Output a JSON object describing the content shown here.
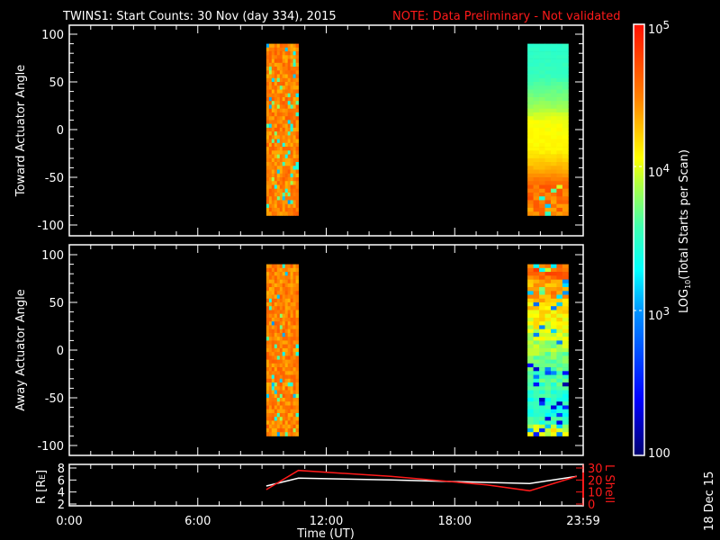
{
  "title": {
    "main": "TWINS1: Start Counts: 30 Nov (day 334), 2015",
    "note": "NOTE: Data Preliminary - Not validated",
    "note_color": "#ff1a1a"
  },
  "date_stamp": "18 Dec 15",
  "chart_data": {
    "type": "heatmap",
    "xlabel": "Time (UT)",
    "x_range_hours": [
      0,
      24
    ],
    "x_ticks": [
      "0:00",
      "6:00",
      "12:00",
      "18:00",
      "23:59"
    ],
    "colorbar": {
      "label": "LOG10(Total Starts per Scan)",
      "label_main": "LOG",
      "label_sub": "10",
      "label_rest": "(Total Starts per Scan)",
      "range_log10": [
        2,
        5
      ],
      "ticks": [
        {
          "base": "100",
          "exp": ""
        },
        {
          "base": "10",
          "exp": "3"
        },
        {
          "base": "10",
          "exp": "4"
        },
        {
          "base": "10",
          "exp": "5"
        }
      ]
    },
    "panels": [
      {
        "ylabel": "Toward Actuator Angle",
        "ylim": [
          -100,
          100
        ],
        "y_ticks": [
          "100",
          "50",
          "0",
          "-50",
          "-100"
        ],
        "blocks": [
          {
            "t_start": 9.2,
            "t_end": 10.7,
            "noisy_from": 90,
            "profile": [
              [
                90,
                4.5
              ],
              [
                0,
                4.5
              ],
              [
                -88,
                4.5
              ]
            ]
          },
          {
            "t_start": 21.4,
            "t_end": 23.3,
            "noisy_from": -58,
            "profile": [
              [
                90,
                3.5
              ],
              [
                60,
                3.55
              ],
              [
                30,
                3.8
              ],
              [
                10,
                4.05
              ],
              [
                -20,
                4.1
              ],
              [
                -40,
                4.35
              ],
              [
                -55,
                4.6
              ],
              [
                -88,
                4.5
              ]
            ]
          }
        ]
      },
      {
        "ylabel": "Away Actuator Angle",
        "ylim": [
          -100,
          100
        ],
        "y_ticks": [
          "100",
          "50",
          "0",
          "-50",
          "-100"
        ],
        "blocks": [
          {
            "t_start": 9.2,
            "t_end": 10.7,
            "noisy_from": 90,
            "profile": [
              [
                90,
                4.5
              ],
              [
                0,
                4.5
              ],
              [
                -88,
                4.5
              ]
            ]
          },
          {
            "t_start": 21.4,
            "t_end": 23.3,
            "noisy_from": 200,
            "profile": [
              [
                90,
                4.6
              ],
              [
                80,
                4.7
              ],
              [
                72,
                4.3
              ],
              [
                65,
                4.5
              ],
              [
                50,
                4.2
              ],
              [
                20,
                4.0
              ],
              [
                0,
                3.8
              ],
              [
                -30,
                3.6
              ],
              [
                -60,
                3.4
              ],
              [
                -75,
                3.55
              ],
              [
                -80,
                4.1
              ],
              [
                -88,
                3.9
              ]
            ]
          }
        ]
      }
    ],
    "orbit": {
      "left_label": "R [R",
      "left_label_sub": "E",
      "left_label_end": "]",
      "right_label": "L Shell",
      "r_range": [
        2,
        8
      ],
      "r_ticks": [
        "2",
        "4",
        "6",
        "8"
      ],
      "l_range": [
        0,
        30
      ],
      "l_ticks": [
        "0",
        "10",
        "20",
        "30"
      ],
      "r_series": {
        "x": [
          9.2,
          10.7,
          15,
          19.5,
          21.5,
          23.7
        ],
        "y": [
          5.0,
          6.3,
          6.0,
          5.6,
          5.4,
          6.6
        ],
        "color": "#ffffff"
      },
      "l_series": {
        "x": [
          9.2,
          10.7,
          15,
          19.5,
          21.5,
          23.7
        ],
        "y": [
          12,
          28,
          23,
          16,
          11,
          23
        ],
        "color": "#ff1a1a"
      }
    }
  }
}
